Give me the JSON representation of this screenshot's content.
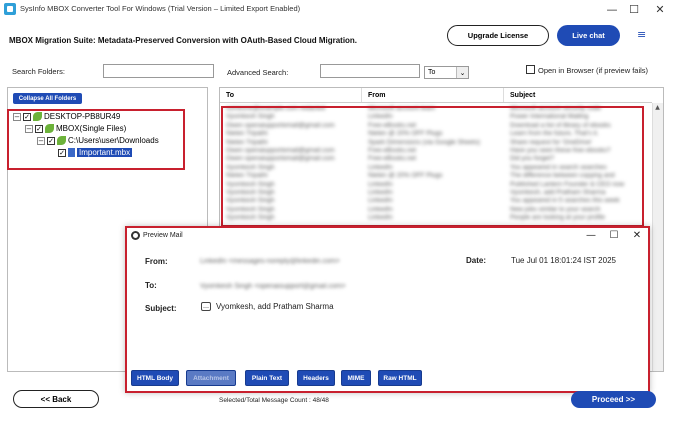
{
  "window": {
    "title": "SysInfo MBOX Converter Tool For Windows (Trial Version – Limited Export Enabled)",
    "minimize": "—",
    "maximize": "☐",
    "close": "✕"
  },
  "header": {
    "suite_title": "MBOX Migration Suite: Metadata-Preserved Conversion with OAuth-Based Cloud Migration.",
    "upgrade_label": "Upgrade License",
    "live_chat_label": "Live chat",
    "menu_icon": "≡"
  },
  "search": {
    "folders_label": "Search Folders:",
    "folders_value": "",
    "advanced_label": "Advanced Search:",
    "advanced_value": "",
    "field_select": "To",
    "open_in_browser_label": "Open in Browser (if preview fails)"
  },
  "tree": {
    "collapse_label": "Collapse All Folders",
    "nodes": [
      {
        "label": "DESKTOP-PB8UR49",
        "expander": "−",
        "checked": "✓"
      },
      {
        "label": "MBOX(Single Files)",
        "expander": "−",
        "checked": "✓"
      },
      {
        "label": "C:\\Users\\user\\Downloads",
        "expander": "−",
        "checked": "✓"
      },
      {
        "label": "Important.mbx",
        "checked": "✓"
      }
    ]
  },
  "grid": {
    "columns": [
      "To",
      "From",
      "Subject"
    ],
    "rows": [
      [
        "someone@example.com redacted",
        "Microsoft account team",
        "Microsoft account security code"
      ],
      [
        "Vyomkesh Singh",
        "LinkedIn",
        "Power International Mailing"
      ],
      [
        "Owen openaiupportemail@gmail.com",
        "Free-eBooks.net",
        "Download a list of library of ebooks"
      ],
      [
        "Nielen Tripathi",
        "Nielen @ 20% OFF Plugs",
        "Learn from the future, That's it."
      ],
      [
        "Nielen Tripathi",
        "Spark Dimensions (via Google Sheets)",
        "Share request for 'OneDrive'"
      ],
      [
        "Owen openaiupportemail@gmail.com",
        "Free-eBooks.net",
        "Have you seen these free ebooks?"
      ],
      [
        "Owen openaiupportemail@gmail.com",
        "Free-eBooks.net",
        "Did you forget?"
      ],
      [
        "Vyomkesh Singh",
        "LinkedIn",
        "You appeared in search searches"
      ],
      [
        "Nielen Tripathi",
        "Nielen @ 20% OFF Plugs",
        "The difference between copying and"
      ],
      [
        "Vyomkesh Singh",
        "LinkedIn",
        "Published Lantern Founder & CEO now"
      ],
      [
        "Vyomkesh Singh",
        "LinkedIn",
        "Vyomkesh, add Pratham Sharma"
      ],
      [
        "Vyomkesh Singh",
        "LinkedIn",
        "You appeared in 5 searches this week"
      ],
      [
        "Vyomkesh Singh",
        "LinkedIn",
        "New jobs similar to your search"
      ],
      [
        "Vyomkesh Singh",
        "LinkedIn",
        "People are looking at your profile"
      ]
    ]
  },
  "preview": {
    "title": "Preview Mail",
    "from_label": "From:",
    "from_value": "LinkedIn <messages-noreply@linkedin.com>",
    "date_label": "Date:",
    "date_value": "Tue Jul 01 18:01:24 IST 2025",
    "to_label": "To:",
    "to_value": "Vyomkesh Singh <openaisupport@gmail.com>",
    "subject_label": "Subject:",
    "subject_value": "Vyomkesh, add Pratham Sharma",
    "subject_icon": "…",
    "buttons": [
      "HTML Body",
      "Attachment",
      "Plain Text",
      "Headers",
      "MIME",
      "Raw HTML"
    ],
    "minimize": "—",
    "maximize": "☐",
    "close": "✕"
  },
  "footer": {
    "back_label": "<< Back",
    "count_text": "Selected/Total Message Count : 48/48",
    "proceed_label": "Proceed >>"
  },
  "colors": {
    "accent": "#1f4bb5",
    "highlight_border": "#c8202e"
  }
}
